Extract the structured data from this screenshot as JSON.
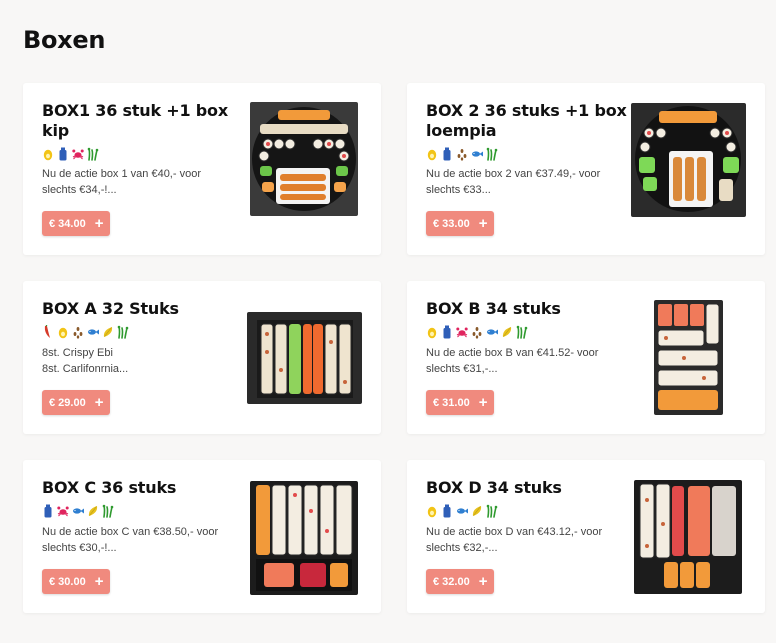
{
  "section": {
    "title": "Boxen"
  },
  "products": [
    {
      "title_lines": [
        "BOX1 36 stuk +1 box",
        "kip"
      ],
      "allergens": [
        "egg-icon",
        "soy-icon",
        "crab-icon",
        "celery-icon"
      ],
      "desc_lines": [
        "Nu de actie box 1 van €40,- voor",
        "slechts €34,-!..."
      ],
      "price": "€ 34.00"
    },
    {
      "title_lines": [
        "BOX 2 36 stuks +1 box",
        "loempia"
      ],
      "allergens": [
        "egg-icon",
        "soy-icon",
        "sesame-icon",
        "fish-icon",
        "celery-icon"
      ],
      "desc_lines": [
        "Nu de actie box 2 van €37.49,- voor",
        "slechts €33..."
      ],
      "price": "€ 33.00"
    },
    {
      "title_lines": [
        "BOX A 32 Stuks"
      ],
      "allergens": [
        "chili-icon",
        "egg-icon",
        "sesame-icon",
        "fish-icon",
        "mustard-icon",
        "celery-icon"
      ],
      "desc_lines": [
        "8st. Crispy Ebi",
        "8st. Carlifonrnia..."
      ],
      "price": "€ 29.00"
    },
    {
      "title_lines": [
        "BOX B 34 stuks"
      ],
      "allergens": [
        "egg-icon",
        "soy-icon",
        "crab-icon",
        "sesame-icon",
        "fish-icon",
        "mustard-icon",
        "celery-icon"
      ],
      "desc_lines": [
        "Nu de actie box B van €41.52- voor",
        "slechts €31,-..."
      ],
      "price": "€ 31.00"
    },
    {
      "title_lines": [
        "BOX C 36 stuks"
      ],
      "allergens": [
        "soy-icon",
        "crab-icon",
        "fish-icon",
        "mustard-icon",
        "celery-icon"
      ],
      "desc_lines": [
        "Nu de actie box C van €38.50,- voor",
        "slechts €30,-!..."
      ],
      "price": "€ 30.00"
    },
    {
      "title_lines": [
        "BOX D 34 stuks"
      ],
      "allergens": [
        "egg-icon",
        "soy-icon",
        "fish-icon",
        "mustard-icon",
        "celery-icon"
      ],
      "desc_lines": [
        "Nu de actie box D van €43.12,- voor",
        "slechts €32,-..."
      ],
      "price": "€ 32.00"
    }
  ],
  "colors": {
    "accent": "#f08a7e",
    "background": "#f8f7f6",
    "card": "#ffffff",
    "egg": "#f2c417",
    "soy": "#2f5fb8",
    "crab": "#e0245e",
    "sesame": "#8a5a2b",
    "fish": "#2f7fd1",
    "mustard": "#e8c21e",
    "celery": "#2f9a2f",
    "chili": "#d63a2a"
  }
}
